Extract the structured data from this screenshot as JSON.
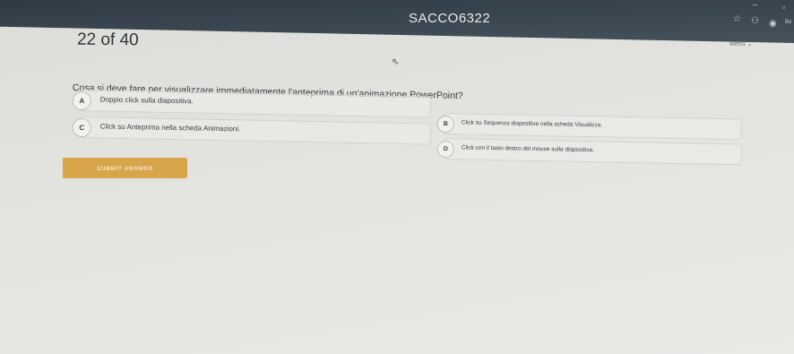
{
  "titlebar": {
    "title": "SACCO6322"
  },
  "window_controls": {
    "minimize": "–",
    "maximize": "▫"
  },
  "browser_toolbar": {
    "star_icon": "☆",
    "profile_icon": "⚇",
    "ext_icon": "◉",
    "label": "Bo"
  },
  "quiz": {
    "counter": "22 of 40",
    "menu_label": "Menu ⌄",
    "question": "Cosa si deve fare per visualizzare immediatamente l'anteprima di un'animazione PowerPoint?",
    "options": [
      {
        "letter": "A",
        "text": "Doppio click sulla diapositiva."
      },
      {
        "letter": "B",
        "text": "Click su Sequenza diapositive nella scheda Visualizza."
      },
      {
        "letter": "C",
        "text": "Click su Anteprima nella scheda Animazioni."
      },
      {
        "letter": "D",
        "text": "Click con il tasto destro del mouse sulla diapositiva."
      }
    ],
    "submit_label": "SUBMIT ANSWER"
  },
  "colors": {
    "accent": "#d8a54a",
    "header": "#36424c"
  }
}
